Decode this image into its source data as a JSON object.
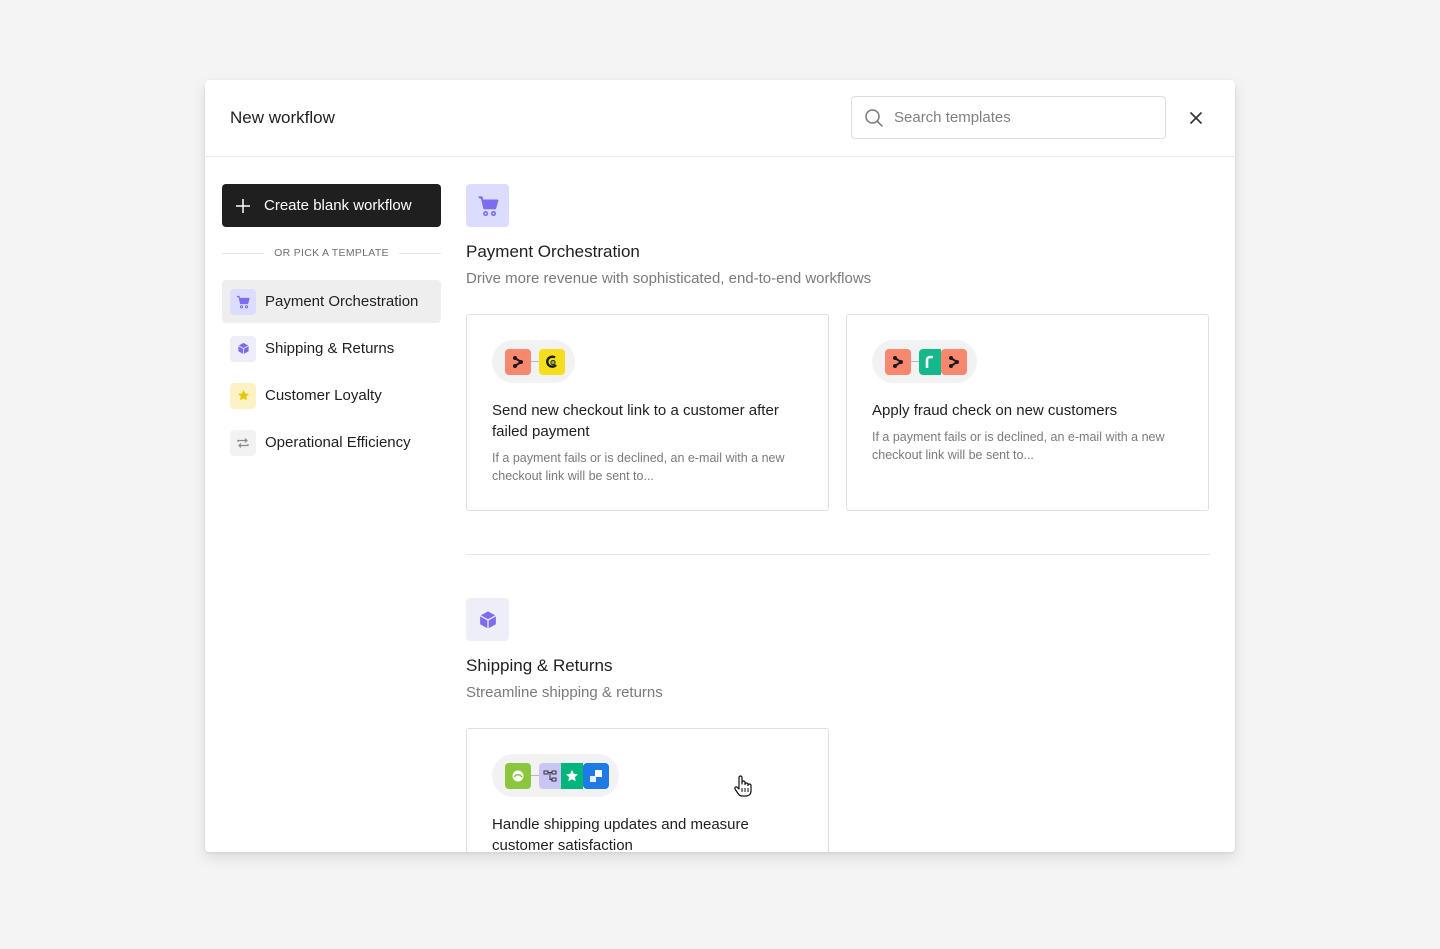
{
  "header": {
    "title": "New workflow",
    "search_placeholder": "Search templates",
    "search_value": "",
    "close_icon": "close-icon"
  },
  "sidebar": {
    "create_button_label": "Create blank workflow",
    "divider_label": "OR PICK A TEMPLATE",
    "items": [
      {
        "label": "Payment Orchestration",
        "icon": "shopping-cart-icon",
        "active": true,
        "icon_bg": "#dcdcff",
        "icon_color": "#7b6cf0"
      },
      {
        "label": "Shipping & Returns",
        "icon": "package-icon",
        "active": false,
        "icon_bg": "#eeeef8",
        "icon_color": "#7b6cf0"
      },
      {
        "label": "Customer Loyalty",
        "icon": "star-icon",
        "active": false,
        "icon_bg": "#fdf1c6",
        "icon_color": "#e6c800"
      },
      {
        "label": "Operational Efficiency",
        "icon": "repeat-icon",
        "active": false,
        "icon_bg": "#f2f2f2",
        "icon_color": "#8a8a8a"
      }
    ]
  },
  "sections": [
    {
      "title": "Payment Orchestration",
      "subtitle": "Drive more revenue with sophisticated, end-to-end workflows",
      "icon": "shopping-cart-icon",
      "cards": [
        {
          "title": "Send new checkout link to a customer after failed payment",
          "description": "If a payment fails or is declined, an e-mail with a new checkout link will be sent to...",
          "apps": [
            "primer-icon",
            "mailchimp-icon"
          ]
        },
        {
          "title": "Apply fraud check on new customers",
          "description": "If a payment fails or is declined, an e-mail with a new checkout link will be sent to...",
          "apps": [
            "primer-icon",
            "riskified-icon",
            "primer-icon"
          ]
        }
      ]
    },
    {
      "title": "Shipping & Returns",
      "subtitle": "Streamline shipping & returns",
      "icon": "package-icon",
      "cards": [
        {
          "title": "Handle shipping updates and measure customer satisfaction",
          "description": "",
          "apps": [
            "shipping-app-icon",
            "workflow-branch-icon",
            "trustpilot-icon",
            "dashboard-app-icon"
          ]
        }
      ]
    }
  ],
  "colors": {
    "primary_dark": "#1f1f1f",
    "accent_purple": "#7b6cf0",
    "primer_salmon": "#f7876f",
    "mailchimp_yellow": "#f6dd1e",
    "riskified_green": "#14b88a",
    "trustpilot_green": "#00b67a",
    "lime_green": "#8cc63f",
    "blue_app": "#1e7be6"
  }
}
